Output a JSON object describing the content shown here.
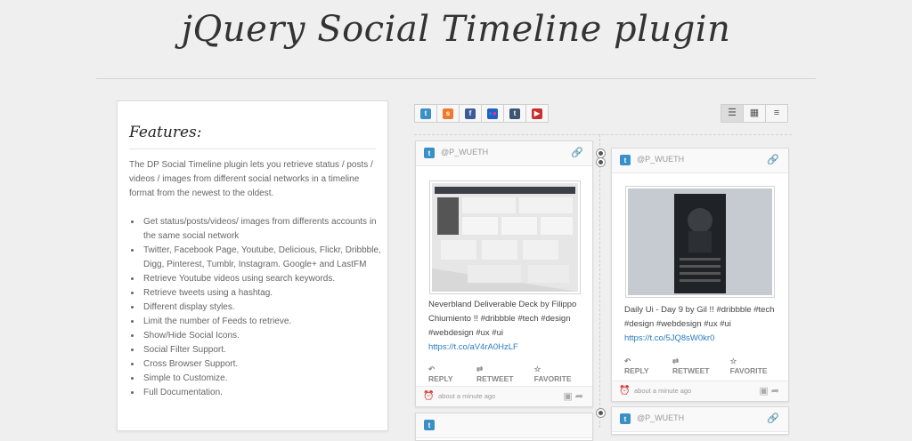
{
  "page": {
    "title": "jQuery Social Timeline plugin"
  },
  "features": {
    "heading": "Features:",
    "intro": "The DP Social Timeline plugin lets you retrieve status / posts / videos / images from different social networks in a timeline format from the newest to the oldest.",
    "items": [
      "Get status/posts/videos/ images from differents accounts in the same social network",
      "Twitter, Facebook Page, Youtube, Delicious, Flickr, Dribbble, Digg, Pinterest, Tumblr, Instagram. Google+ and LastFM",
      "Retrieve Youtube videos using search keywords.",
      "Retrieve tweets using a hashtag.",
      "Different display styles.",
      "Limit the number of Feeds to retrieve.",
      "Show/Hide Social Icons.",
      "Social Filter Support.",
      "Cross Browser Support.",
      "Simple to Customize.",
      "Full Documentation."
    ]
  },
  "filters": [
    {
      "name": "twitter",
      "icon": "twitter-icon",
      "glyph": "t",
      "color": "#3a8fc6"
    },
    {
      "name": "soundcloud",
      "icon": "soundcloud-icon",
      "glyph": "s",
      "color": "#ee7a2a"
    },
    {
      "name": "facebook",
      "icon": "facebook-icon",
      "glyph": "f",
      "color": "#3b5b9a"
    },
    {
      "name": "flickr",
      "icon": "flickr-icon",
      "glyph": "••",
      "color": "#1f61c4"
    },
    {
      "name": "tumblr",
      "icon": "tumblr-icon",
      "glyph": "t",
      "color": "#3c5671"
    },
    {
      "name": "youtube",
      "icon": "youtube-icon",
      "glyph": "▶",
      "color": "#c9302c"
    }
  ],
  "views": [
    {
      "name": "timeline-view",
      "icon": "timeline-icon",
      "glyph": "☰",
      "active": true
    },
    {
      "name": "grid-view",
      "icon": "grid-icon",
      "glyph": "▦",
      "active": false
    },
    {
      "name": "list-view",
      "icon": "list-icon",
      "glyph": "≡",
      "active": false
    }
  ],
  "posts": [
    {
      "user": "@P_WUETH",
      "text": "Neverbland Deliverable Deck by Filippo Chiumiento !! #dribbble #tech #design #webdesign #ux #ui",
      "url": "https://t.co/aV4rA0HzLF",
      "reply": "REPLY",
      "retweet": "RETWEET",
      "favorite": "FAVORITE",
      "time": "about a minute ago"
    },
    {
      "user": "@P_WUETH",
      "text": "Daily Ui - Day 9 by Gil !! #dribbble #tech #design #webdesign #ux #ui",
      "url": "https://t.co/5JQ8sW0kr0",
      "reply": "REPLY",
      "retweet": "RETWEET",
      "favorite": "FAVORITE",
      "time": "about a minute ago"
    },
    {
      "user": "@P_WUETH"
    }
  ]
}
